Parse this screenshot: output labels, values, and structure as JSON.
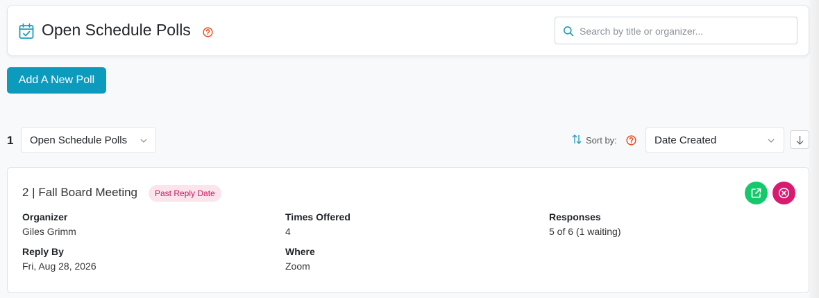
{
  "header": {
    "title": "Open Schedule Polls",
    "search_placeholder": "Search by title or organizer..."
  },
  "actions": {
    "add_poll_label": "Add A New Poll"
  },
  "toolbar": {
    "count": "1",
    "filter_value": "Open Schedule Polls",
    "sort_label": "Sort by:",
    "sort_value": "Date Created"
  },
  "poll": {
    "title": "2 | Fall Board Meeting",
    "status": "Past Reply Date",
    "fields": {
      "organizer_label": "Organizer",
      "organizer_value": "Giles Grimm",
      "times_label": "Times Offered",
      "times_value": "4",
      "responses_label": "Responses",
      "responses_value": "5 of 6 (1 waiting)",
      "reply_by_label": "Reply By",
      "reply_by_value": "Fri, Aug 28, 2026",
      "where_label": "Where",
      "where_value": "Zoom"
    }
  },
  "colors": {
    "accent": "#0d9bbd",
    "help_icon": "#e8491d",
    "open_button": "#14c96b",
    "close_button": "#d81b70",
    "badge_text": "#c2185b",
    "badge_bg": "#fce4ec"
  },
  "icons": {
    "title": "calendar-check-icon",
    "help": "question-circle-icon",
    "search": "search-icon",
    "sort": "sort-arrows-icon",
    "sort_direction": "arrow-down-icon",
    "open": "external-link-icon",
    "close": "close-circle-icon"
  }
}
